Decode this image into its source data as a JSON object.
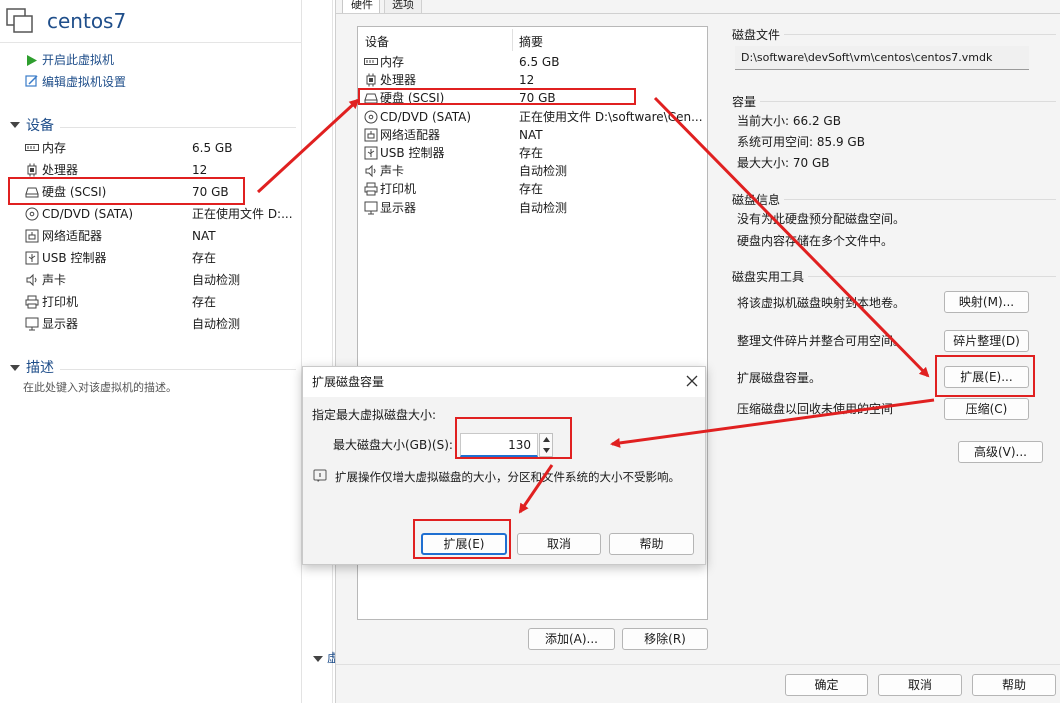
{
  "vm": {
    "title": "centos7",
    "actions": [
      "开启此虚拟机",
      "编辑虚拟机设置"
    ]
  },
  "left": {
    "devices_heading": "设备",
    "devices": [
      {
        "name": "内存",
        "value": "6.5 GB",
        "icon": "memory-icon"
      },
      {
        "name": "处理器",
        "value": "12",
        "icon": "cpu-icon"
      },
      {
        "name": "硬盘 (SCSI)",
        "value": "70 GB",
        "icon": "hard-disk-icon"
      },
      {
        "name": "CD/DVD (SATA)",
        "value": "正在使用文件 D:...",
        "icon": "cd-dvd-icon"
      },
      {
        "name": "网络适配器",
        "value": "NAT",
        "icon": "network-adapter-icon"
      },
      {
        "name": "USB 控制器",
        "value": "存在",
        "icon": "usb-icon"
      },
      {
        "name": "声卡",
        "value": "自动检测",
        "icon": "speaker-icon"
      },
      {
        "name": "打印机",
        "value": "存在",
        "icon": "printer-icon"
      },
      {
        "name": "显示器",
        "value": "自动检测",
        "icon": "monitor-icon"
      }
    ],
    "description_heading": "描述",
    "description_placeholder": "在此处键入对该虚拟机的描述。",
    "bottom_fragment": "虚"
  },
  "settings": {
    "tabs": [
      "硬件",
      "选项"
    ],
    "table_headers": [
      "设备",
      "摘要"
    ],
    "devices": [
      {
        "name": "内存",
        "value": "6.5 GB",
        "icon": "memory-icon"
      },
      {
        "name": "处理器",
        "value": "12",
        "icon": "cpu-icon"
      },
      {
        "name": "硬盘 (SCSI)",
        "value": "70 GB",
        "icon": "hard-disk-icon"
      },
      {
        "name": "CD/DVD (SATA)",
        "value": "正在使用文件 D:\\software\\Cen...",
        "icon": "cd-dvd-icon"
      },
      {
        "name": "网络适配器",
        "value": "NAT",
        "icon": "network-adapter-icon"
      },
      {
        "name": "USB 控制器",
        "value": "存在",
        "icon": "usb-icon"
      },
      {
        "name": "声卡",
        "value": "自动检测",
        "icon": "speaker-icon"
      },
      {
        "name": "打印机",
        "value": "存在",
        "icon": "printer-icon"
      },
      {
        "name": "显示器",
        "value": "自动检测",
        "icon": "monitor-icon"
      }
    ],
    "add_button": "添加(A)...",
    "remove_button": "移除(R)",
    "disk_file_title": "磁盘文件",
    "disk_file_path": "D:\\software\\devSoft\\vm\\centos\\centos7.vmdk",
    "capacity_title": "容量",
    "capacity_lines": [
      "当前大小: 66.2 GB",
      "系统可用空间: 85.9 GB",
      "最大大小: 70 GB"
    ],
    "disk_info_title": "磁盘信息",
    "disk_info_lines": [
      "没有为此硬盘预分配磁盘空间。",
      "硬盘内容存储在多个文件中。"
    ],
    "utilities_title": "磁盘实用工具",
    "utilities": [
      {
        "label": "将该虚拟机磁盘映射到本地卷。",
        "button": "映射(M)..."
      },
      {
        "label": "整理文件碎片并整合可用空间。",
        "button": "碎片整理(D)"
      },
      {
        "label": "扩展磁盘容量。",
        "button": "扩展(E)..."
      },
      {
        "label": "压缩磁盘以回收未使用的空间",
        "button": "压缩(C)"
      }
    ],
    "advanced_button": "高级(V)...",
    "ok_button": "确定",
    "cancel_button": "取消",
    "help_button": "帮助"
  },
  "dialog": {
    "title": "扩展磁盘容量",
    "instruction": "指定最大虚拟磁盘大小:",
    "field_label": "最大磁盘大小(GB)(S):",
    "value": "130",
    "note": "扩展操作仅增大虚拟磁盘的大小，分区和文件系统的大小不受影响。",
    "expand_button": "扩展(E)",
    "cancel_button": "取消",
    "help_button": "帮助"
  },
  "colors": {
    "accent_blue": "#1f6fd1",
    "annotation_red": "#e02020",
    "play_green": "#2e9e2e"
  }
}
